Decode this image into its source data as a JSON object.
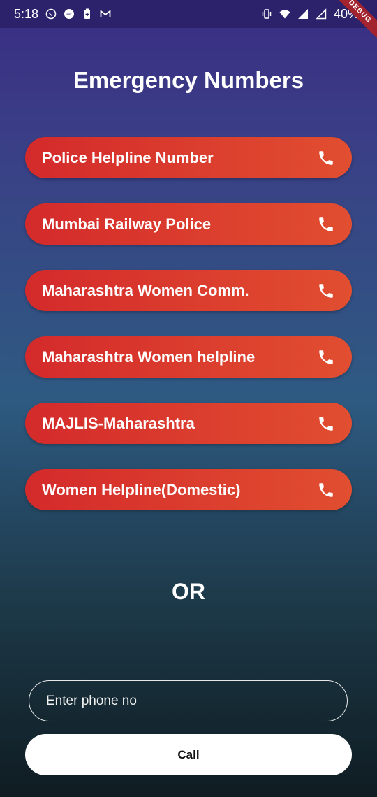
{
  "status_bar": {
    "time": "5:18",
    "battery": "40%",
    "left_icons": [
      "whatsapp-icon",
      "chat-icon",
      "battery-saver-icon",
      "gmail-icon"
    ],
    "right_icons": [
      "vibrate-icon",
      "wifi-icon",
      "signal-icon",
      "signal-empty-icon",
      "battery-icon"
    ]
  },
  "debug_banner": "DEBUG",
  "page": {
    "title": "Emergency Numbers",
    "or_text": "OR"
  },
  "emergency_buttons": [
    {
      "label": "Police Helpline Number",
      "icon": "phone-icon"
    },
    {
      "label": "Mumbai Railway Police",
      "icon": "phone-icon"
    },
    {
      "label": "Maharashtra Women Comm.",
      "icon": "phone-icon"
    },
    {
      "label": "Maharashtra Women helpline",
      "icon": "phone-icon"
    },
    {
      "label": "MAJLIS-Maharashtra",
      "icon": "phone-icon"
    },
    {
      "label": "Women Helpline(Domestic)",
      "icon": "phone-icon"
    }
  ],
  "phone_input": {
    "placeholder": "Enter phone no",
    "value": ""
  },
  "call_button": {
    "label": "Call"
  },
  "colors": {
    "button_gradient_start": "#d42a2b",
    "button_gradient_end": "#e14e30",
    "background_top": "#3a2d84",
    "background_bottom": "#0f1c22"
  }
}
